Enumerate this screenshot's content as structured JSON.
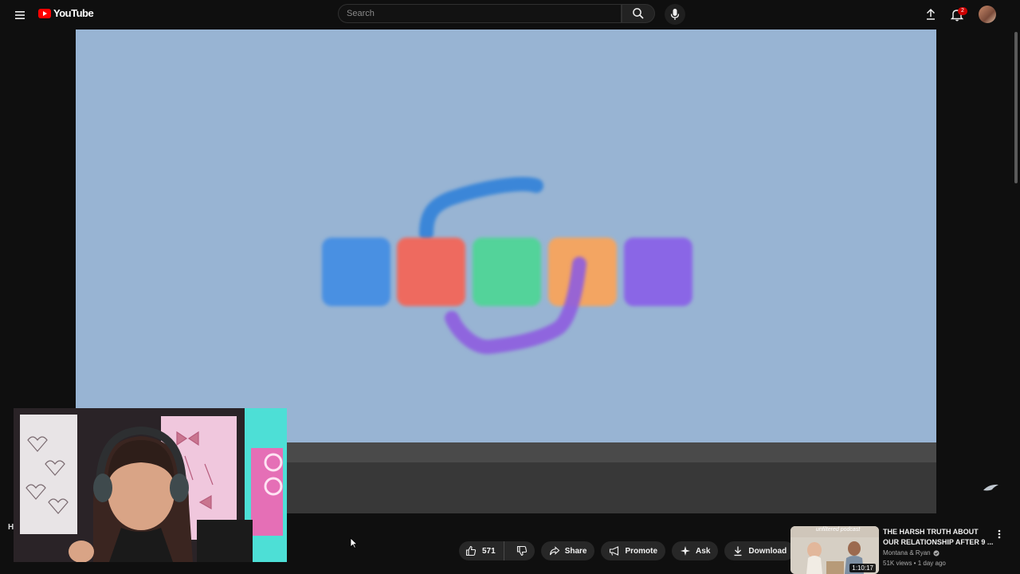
{
  "header": {
    "logo_text": "YouTube",
    "search_placeholder": "Search",
    "notifications_count": "2"
  },
  "colors": {
    "video_bg": "#98b4d3",
    "square_colors": [
      "#4a90e2",
      "#ee6b5e",
      "#52d39a",
      "#f3a562",
      "#8a66e6"
    ],
    "stroke_top": "#3b86d8",
    "stroke_bottom": "#8e5ce0",
    "accent_red": "#ff0000"
  },
  "actions": {
    "like_count": "571",
    "share_label": "Share",
    "promote_label": "Promote",
    "ask_label": "Ask",
    "download_label": "Download"
  },
  "recommendation": {
    "thumb_caption": "unfiltered podcast",
    "title": "THE HARSH TRUTH ABOUT OUR RELATIONSHIP AFTER 9 ...",
    "channel": "Montana & Ryan",
    "meta": "51K views • 1 day ago",
    "duration": "1:10:17"
  },
  "edge_text": "H"
}
